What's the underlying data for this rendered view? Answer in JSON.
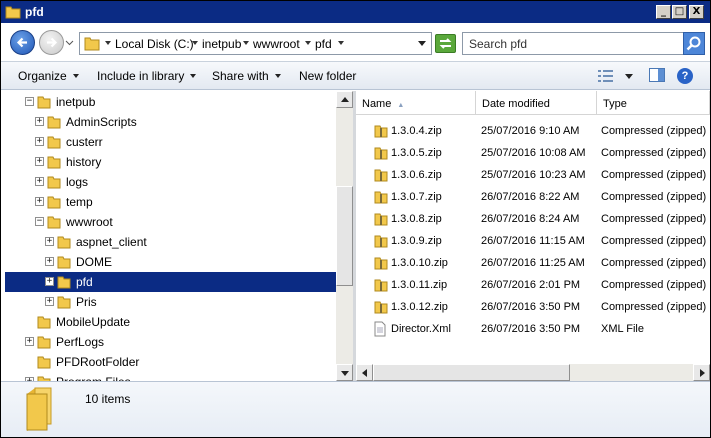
{
  "window": {
    "title": "pfd",
    "minimize": "_",
    "maximize": "□",
    "close": "X"
  },
  "address": {
    "crumbs": [
      "Local Disk (C:)",
      "inetpub",
      "wwwroot",
      "pfd"
    ]
  },
  "search": {
    "placeholder": "Search pfd"
  },
  "toolbar": {
    "organize": "Organize",
    "include": "Include in library",
    "share": "Share with",
    "newfolder": "New folder"
  },
  "tree": [
    {
      "label": "inetpub",
      "expander": "−"
    },
    {
      "label": "AdminScripts",
      "expander": "+"
    },
    {
      "label": "custerr",
      "expander": "+"
    },
    {
      "label": "history",
      "expander": "+"
    },
    {
      "label": "logs",
      "expander": "+"
    },
    {
      "label": "temp",
      "expander": "+"
    },
    {
      "label": "wwwroot",
      "expander": "−"
    },
    {
      "label": "aspnet_client",
      "expander": "+"
    },
    {
      "label": "DOME",
      "expander": "+"
    },
    {
      "label": "pfd",
      "expander": "+"
    },
    {
      "label": "Pris",
      "expander": "+"
    },
    {
      "label": "MobileUpdate",
      "expander": ""
    },
    {
      "label": "PerfLogs",
      "expander": "+"
    },
    {
      "label": "PFDRootFolder",
      "expander": ""
    },
    {
      "label": "Program Files",
      "expander": "+"
    }
  ],
  "columns": {
    "name": "Name",
    "date": "Date modified",
    "type": "Type"
  },
  "files": [
    {
      "name": "1.3.0.4.zip",
      "date": "25/07/2016 9:10 AM",
      "type": "Compressed (zipped) F"
    },
    {
      "name": "1.3.0.5.zip",
      "date": "25/07/2016 10:08 AM",
      "type": "Compressed (zipped) F"
    },
    {
      "name": "1.3.0.6.zip",
      "date": "25/07/2016 10:23 AM",
      "type": "Compressed (zipped) F"
    },
    {
      "name": "1.3.0.7.zip",
      "date": "26/07/2016 8:22 AM",
      "type": "Compressed (zipped) F"
    },
    {
      "name": "1.3.0.8.zip",
      "date": "26/07/2016 8:24 AM",
      "type": "Compressed (zipped) F"
    },
    {
      "name": "1.3.0.9.zip",
      "date": "26/07/2016 11:15 AM",
      "type": "Compressed (zipped) F"
    },
    {
      "name": "1.3.0.10.zip",
      "date": "26/07/2016 11:25 AM",
      "type": "Compressed (zipped) F"
    },
    {
      "name": "1.3.0.11.zip",
      "date": "26/07/2016 2:01 PM",
      "type": "Compressed (zipped) F"
    },
    {
      "name": "1.3.0.12.zip",
      "date": "26/07/2016 3:50 PM",
      "type": "Compressed (zipped) F"
    },
    {
      "name": "Director.Xml",
      "date": "26/07/2016 3:50 PM",
      "type": "XML File"
    }
  ],
  "status": {
    "items": "10 items"
  },
  "help_label": "?"
}
